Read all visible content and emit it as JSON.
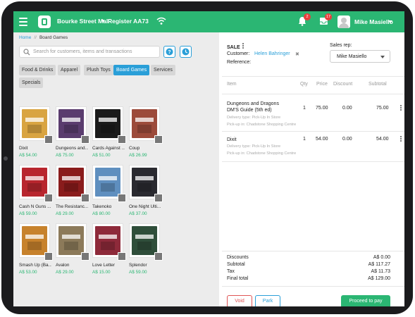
{
  "header": {
    "store": "Bourke Street Mall",
    "register": "Register AA73",
    "alerts_count": "2",
    "messages_count": "17",
    "user_name": "Mike Masiello"
  },
  "breadcrumb": {
    "home": "Home",
    "current": "Board Games"
  },
  "search": {
    "placeholder": "Search for customers, items and transactions"
  },
  "categories": [
    "Food & Drinks",
    "Apparel",
    "Plush Toys",
    "Board Games",
    "Services",
    "Specials"
  ],
  "active_category": "Board Games",
  "products": [
    {
      "name": "Dixit",
      "price": "A$ 54.00",
      "color": "#d9a441"
    },
    {
      "name": "Dungeons and...",
      "price": "A$ 75.00",
      "color": "#5a3c6e"
    },
    {
      "name": "Cards Against ...",
      "price": "A$ 51.00",
      "color": "#1a1a1a"
    },
    {
      "name": "Coup",
      "price": "A$ 26.99",
      "color": "#9c4a3a"
    },
    {
      "name": "Cash N Guns ...",
      "price": "A$ 59.00",
      "color": "#b8262e"
    },
    {
      "name": "The Resistanc...",
      "price": "A$ 29.00",
      "color": "#8a1c1c"
    },
    {
      "name": "Takenoko",
      "price": "A$ 80.00",
      "color": "#5f8fbf"
    },
    {
      "name": "One Night Ulti...",
      "price": "A$ 37.00",
      "color": "#2a2a30"
    },
    {
      "name": "Smash Up (Ba...",
      "price": "A$ 53.00",
      "color": "#c7822c"
    },
    {
      "name": "Avalon",
      "price": "A$ 29.00",
      "color": "#8c7a5a"
    },
    {
      "name": "Love Letter",
      "price": "A$ 15.00",
      "color": "#8e2a3a"
    },
    {
      "name": "Splendor",
      "price": "A$ 59.00",
      "color": "#2f4e3a"
    }
  ],
  "sale": {
    "title": "SALE",
    "customer_label": "Customer:",
    "customer_name": "Helen Bahringer",
    "reference_label": "Reference:",
    "sales_rep_label": "Sales rep:",
    "sales_rep_value": "Mike Masiello"
  },
  "line_headers": {
    "item": "Item",
    "qty": "Qty",
    "price": "Price",
    "discount": "Discount",
    "subtotal": "Subtotal"
  },
  "lines": [
    {
      "name_1": "Dungeons and Dragons",
      "name_2": "DM'S Guide (5th ed)",
      "delivery": "Delivery type: Pick-Up In Store",
      "pickup": "Pick-up in: Chadstone Shopping Centre",
      "qty": "1",
      "price": "75.00",
      "discount": "0.00",
      "subtotal": "75.00"
    },
    {
      "name_1": "Dixit",
      "delivery": "Delivery type: Pick-Up In Store",
      "pickup": "Pick-up in: Chadstone Shopping Centre",
      "qty": "1",
      "price": "54.00",
      "discount": "0.00",
      "subtotal": "54.00"
    }
  ],
  "totals": [
    {
      "label": "Discounts",
      "value": "A$ 0.00"
    },
    {
      "label": "Subtotal",
      "value": "A$ 117.27"
    },
    {
      "label": "Tax",
      "value": "A$ 11.73"
    },
    {
      "label": "Final total",
      "value": "A$ 129.00"
    }
  ],
  "actions": {
    "void": "Void",
    "park": "Park",
    "proceed": "Proceed to pay"
  },
  "colors": {
    "brand_green": "#2bb673",
    "link_blue": "#2a9fd8",
    "danger_red": "#e05555",
    "badge_red": "#e83e3e"
  }
}
